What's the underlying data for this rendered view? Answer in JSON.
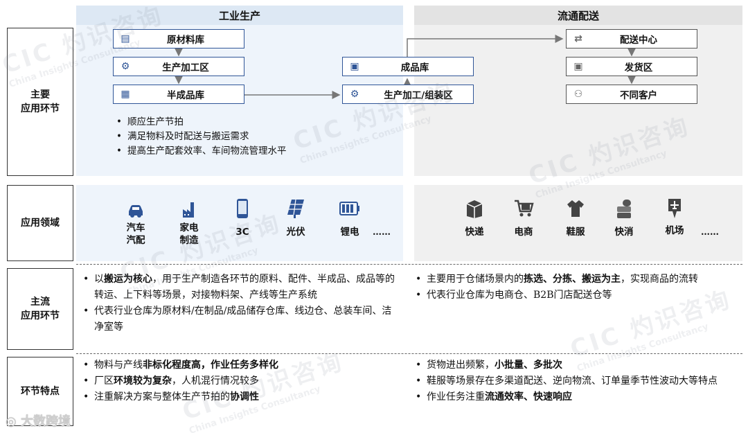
{
  "headers": {
    "industrial": "工业生产",
    "distribution": "流通配送"
  },
  "row_labels": {
    "main_application": [
      "主要",
      "应用环节"
    ],
    "application_field": "应用领域",
    "mainstream_application": [
      "主流",
      "应用环节"
    ],
    "link_features": "环节特点"
  },
  "industrial_flow": {
    "raw_material": "原材料库",
    "production_area": "生产加工区",
    "semi_finished": "半成品库",
    "finished": "成品库",
    "assembly": "生产加工/组装区"
  },
  "distribution_flow": {
    "center": "配送中心",
    "shipping": "发货区",
    "customers": "不同客户"
  },
  "industrial_bullets": [
    "顺应生产节拍",
    "满足物料及时配送与搬运需求",
    "提高生产配套效率、车间物流管理水平"
  ],
  "industrial_domains": [
    {
      "label1": "汽车",
      "label2": "汽配",
      "icon": "car-icon"
    },
    {
      "label1": "家电",
      "label2": "制造",
      "icon": "factory-icon"
    },
    {
      "label1": "3C",
      "label2": "",
      "icon": "phone-icon"
    },
    {
      "label1": "光伏",
      "label2": "",
      "icon": "solar-panel-icon"
    },
    {
      "label1": "锂电",
      "label2": "",
      "icon": "battery-icon"
    }
  ],
  "industrial_more": "……",
  "distribution_domains": [
    {
      "label": "快递",
      "icon": "parcel-icon"
    },
    {
      "label": "电商",
      "icon": "cart-icon"
    },
    {
      "label": "鞋服",
      "icon": "clothes-icon"
    },
    {
      "label": "快消",
      "icon": "consumer-goods-icon"
    },
    {
      "label": "机场",
      "icon": "airport-icon"
    }
  ],
  "distribution_more": "……",
  "mainstream_industrial": [
    {
      "pre": "以",
      "bold": "搬运为核心",
      "post": "，用于生产制造各环节的原料、配件、半成品、成品等的转运、上下料等场景，对接物料架、产线等生产系统"
    },
    {
      "pre": "代表行业仓库为原材料/在制品/成品储存仓库、线边仓、总装车间、洁净室等",
      "bold": "",
      "post": ""
    }
  ],
  "mainstream_distribution": [
    {
      "pre": "主要用于仓储场景内的",
      "bold": "拣选、分拣、搬运为主",
      "post": "，实现商品的流转"
    },
    {
      "pre": "代表行业仓库为电商仓、B2B门店配送仓等",
      "bold": "",
      "post": ""
    }
  ],
  "features_industrial": [
    {
      "pre": "物料与产线",
      "bold": "非标化程度高，作业任务多样化",
      "post": ""
    },
    {
      "pre": "厂区",
      "bold": "环境较为复杂",
      "post": "，人机混行情况较多"
    },
    {
      "pre": "注重解决方案与整体生产节拍的",
      "bold": "协调性",
      "post": ""
    }
  ],
  "features_distribution": [
    {
      "pre": "货物进出频繁，",
      "bold": "小批量、多批次",
      "post": ""
    },
    {
      "pre": "鞋服等场景存在多渠道配送、逆向物流、订单量季节性波动大等特点",
      "bold": "",
      "post": ""
    },
    {
      "pre": "作业任务注重",
      "bold": "流通效率、快速响应",
      "post": ""
    }
  ],
  "watermark": {
    "logo": "CIC 灼识咨询",
    "sub": "China Insights Consultancy"
  },
  "footer_mark": "大数跨境",
  "colors": {
    "blue": "#2f5597",
    "industrial_bg": "#eef4fb",
    "distribution_bg": "#f0f0f0"
  }
}
